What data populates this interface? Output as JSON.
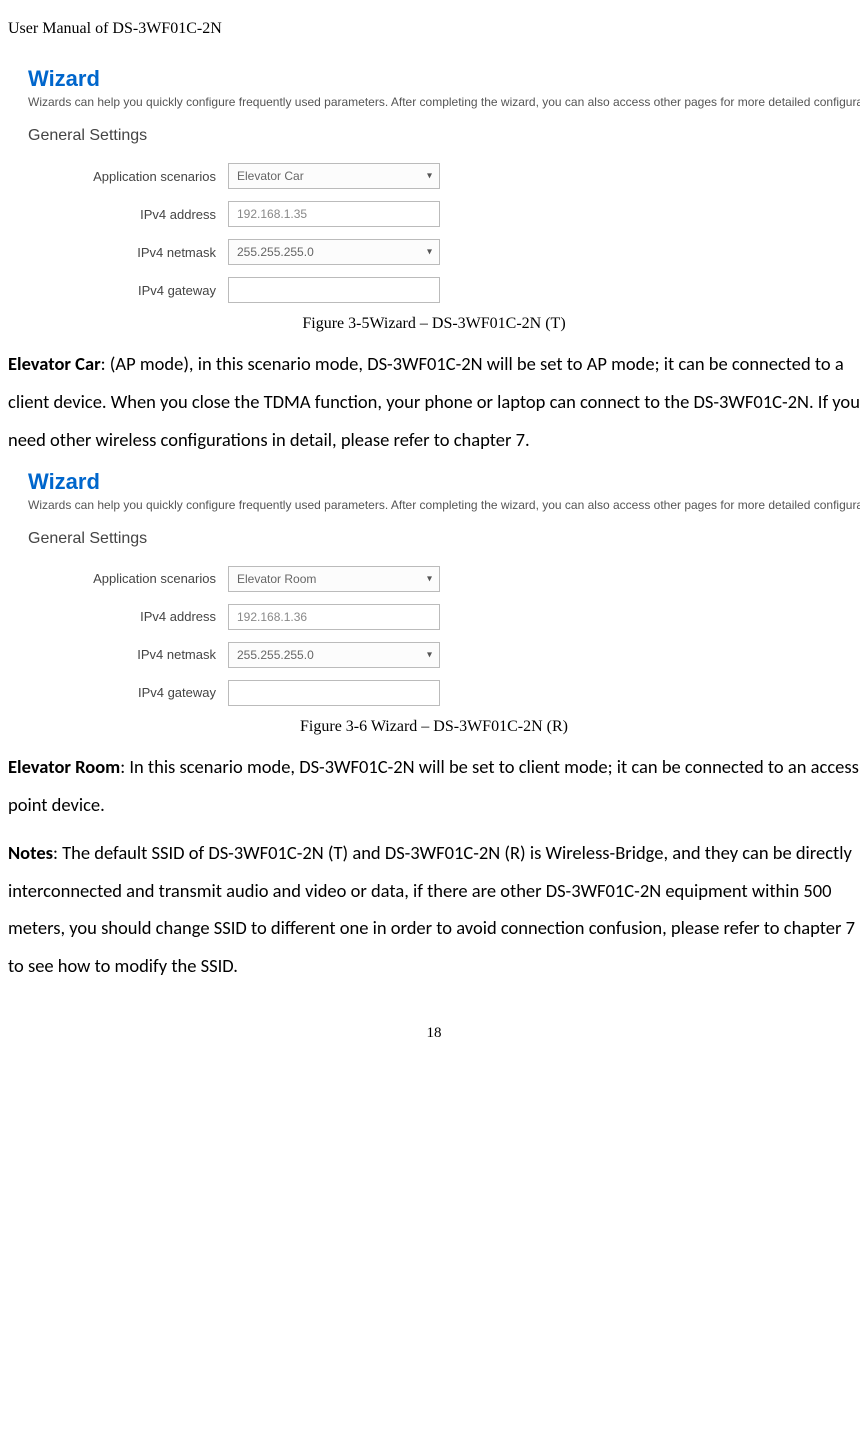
{
  "header": "User Manual of DS-3WF01C-2N",
  "wizard1": {
    "title": "Wizard",
    "subtitle": "Wizards can help you quickly configure frequently used parameters. After completing the wizard, you can also access other pages for more detailed configuration.",
    "section": "General Settings",
    "fields": {
      "scenario_label": "Application scenarios",
      "scenario_value": "Elevator Car",
      "ipv4_addr_label": "IPv4 address",
      "ipv4_addr_value": "192.168.1.35",
      "ipv4_netmask_label": "IPv4 netmask",
      "ipv4_netmask_value": "255.255.255.0",
      "ipv4_gateway_label": "IPv4 gateway",
      "ipv4_gateway_value": ""
    }
  },
  "figure1_caption": "Figure 3-5Wizard – DS-3WF01C-2N (T)",
  "para1_bold": "Elevator Car",
  "para1_rest": ": (AP mode), in this scenario mode, DS-3WF01C-2N will be set to AP mode; it can be connected to a client device. When you close the TDMA function, your phone or laptop can connect to the DS-3WF01C-2N. If you need other wireless configurations in detail, please refer to chapter 7.",
  "wizard2": {
    "title": "Wizard",
    "subtitle": "Wizards can help you quickly configure frequently used parameters. After completing the wizard, you can also access other pages for more detailed configuration.",
    "section": "General Settings",
    "fields": {
      "scenario_label": "Application scenarios",
      "scenario_value": "Elevator Room",
      "ipv4_addr_label": "IPv4 address",
      "ipv4_addr_value": "192.168.1.36",
      "ipv4_netmask_label": "IPv4 netmask",
      "ipv4_netmask_value": "255.255.255.0",
      "ipv4_gateway_label": "IPv4 gateway",
      "ipv4_gateway_value": ""
    }
  },
  "figure2_caption": "Figure 3-6 Wizard – DS-3WF01C-2N (R)",
  "para2_bold": "Elevator Room",
  "para2_rest": ": In this scenario mode, DS-3WF01C-2N will be set to client mode; it can be connected to an access point device.",
  "para3_bold": "Notes",
  "para3_rest": ": The default SSID of DS-3WF01C-2N (T) and DS-3WF01C-2N (R) is Wireless-Bridge, and they can be directly interconnected and transmit audio and video or data, if there are other DS-3WF01C-2N equipment within 500 meters, you should change SSID to different one in order to avoid connection confusion, please refer to chapter 7 to see how to modify the SSID.",
  "page_number": "18"
}
